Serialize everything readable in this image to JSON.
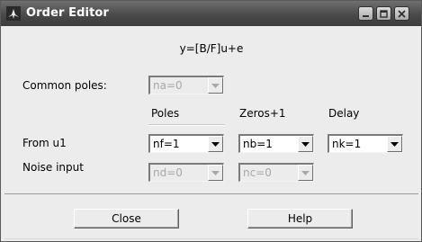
{
  "window": {
    "title": "Order Editor",
    "icon": "matlab-logo-icon",
    "controls": [
      "minimize-icon",
      "maximize-icon",
      "close-icon"
    ]
  },
  "formula": "y=[B/F]u+e",
  "common_poles": {
    "label": "Common poles:",
    "select": {
      "value": "na=0",
      "enabled": false
    }
  },
  "columns": {
    "poles": "Poles",
    "zeros": "Zeros+1",
    "delay": "Delay"
  },
  "rows": {
    "from_u1": {
      "label": "From u1",
      "poles": {
        "value": "nf=1",
        "enabled": true
      },
      "zeros": {
        "value": "nb=1",
        "enabled": true
      },
      "delay": {
        "value": "nk=1",
        "enabled": true
      }
    },
    "noise_input": {
      "label": "Noise input",
      "poles": {
        "value": "nd=0",
        "enabled": false
      },
      "zeros": {
        "value": "nc=0",
        "enabled": false
      }
    }
  },
  "buttons": {
    "close": "Close",
    "help": "Help"
  }
}
